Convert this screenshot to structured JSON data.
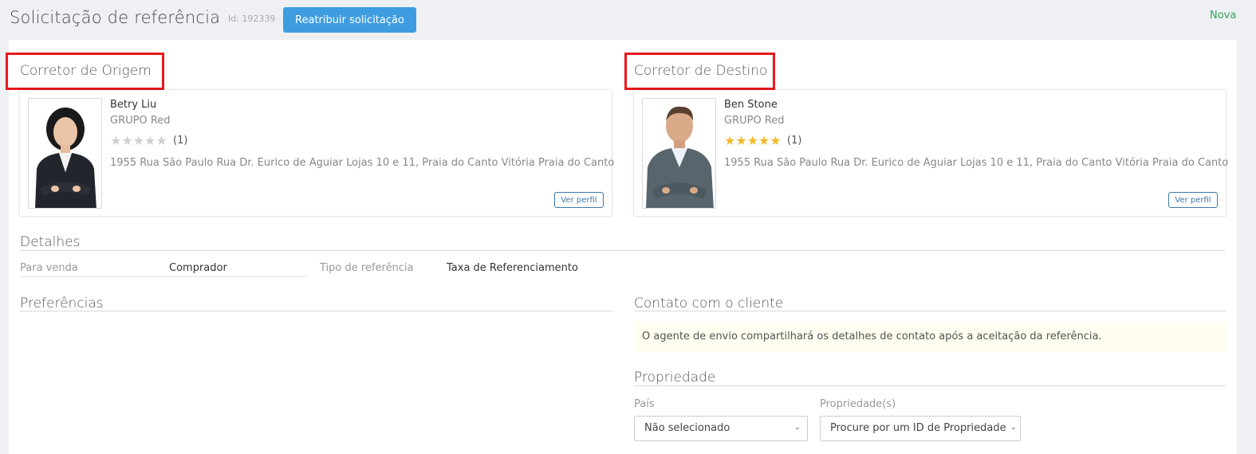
{
  "header": {
    "title": "Solicitação de referência",
    "id_label": "Id: 192339",
    "reassign_button": "Reatribuir solicitação",
    "status": "Nova",
    "status_color": "#3aa154",
    "accent_color": "#3e9de0"
  },
  "origin": {
    "section_title": "Corretor de Origem",
    "name": "Betry Liu",
    "company": "GRUPO Red",
    "rating": 0,
    "rating_count": "(1)",
    "address": "1955 Rua São Paulo Rua Dr. Eurico de Aguiar Lojas 10 e 11, Praia do Canto Vitória Praia do Canto",
    "profile_button": "Ver perfil",
    "avatar_icon": "female-agent-photo"
  },
  "destination": {
    "section_title": "Corretor de Destino",
    "name": "Ben Stone",
    "company": "GRUPO Red",
    "rating": 5,
    "rating_count": "(1)",
    "address": "1955 Rua São Paulo Rua Dr. Eurico de Aguiar Lojas 10 e 11, Praia do Canto Vitória Praia do Canto",
    "profile_button": "Ver perfil",
    "avatar_icon": "male-agent-photo"
  },
  "details": {
    "title": "Detalhes",
    "for_sale_label": "Para venda",
    "for_sale_value": "Comprador",
    "ref_type_label": "Tipo de referência",
    "ref_type_value": "Taxa de Referenciamento"
  },
  "preferences": {
    "title": "Preferências"
  },
  "client_contact": {
    "title": "Contato com o cliente",
    "notice": "O agente de envio compartilhará os detalhes de contato após a aceitação da referência."
  },
  "property": {
    "title": "Propriedade",
    "country_label": "País",
    "country_value": "Não selecionado",
    "property_label": "Propriedade(s)",
    "property_placeholder": "Procure por um ID de Propriedade"
  }
}
